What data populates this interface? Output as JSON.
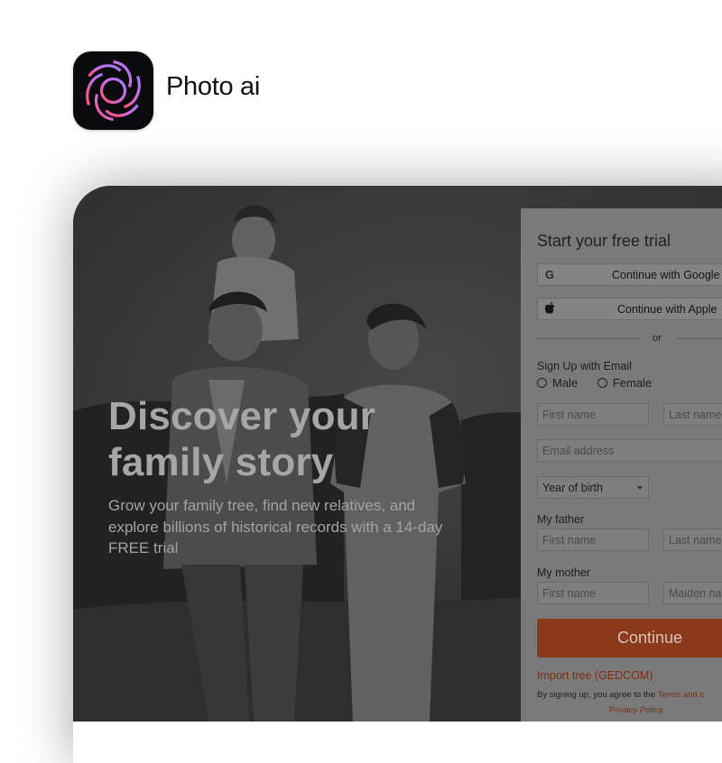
{
  "app": {
    "name": "Photo ai",
    "icon": "swirl-aperture-icon"
  },
  "hero": {
    "title": "Discover your family story",
    "subtitle": "Grow your family tree, find new relatives, and explore billions of historical records with a 14-day FREE trial"
  },
  "signup": {
    "title": "Start your free trial",
    "google_label": "Continue with Google",
    "apple_label": "Continue with Apple",
    "or_text": "or",
    "email_section_label": "Sign Up with Email",
    "gender_options": [
      "Male",
      "Female"
    ],
    "first_name_placeholder": "First name",
    "last_name_placeholder": "Last name",
    "email_placeholder": "Email address",
    "year_of_birth": "Year of birth",
    "father_label": "My father",
    "father_first_placeholder": "First name",
    "father_last_placeholder": "Last name",
    "mother_label": "My mother",
    "mother_first_placeholder": "First name",
    "mother_maiden_placeholder": "Maiden name",
    "continue_label": "Continue",
    "import_link": "Import tree (GEDCOM)",
    "terms_prefix": "By signing up, you agree to the",
    "terms_link": "Terms and c",
    "privacy_link": "Privacy Policy."
  },
  "colors": {
    "accent": "#8a3a1b",
    "link": "#7a2e12",
    "icon_gradient": [
      "#ff5a7a",
      "#b57bff"
    ]
  }
}
